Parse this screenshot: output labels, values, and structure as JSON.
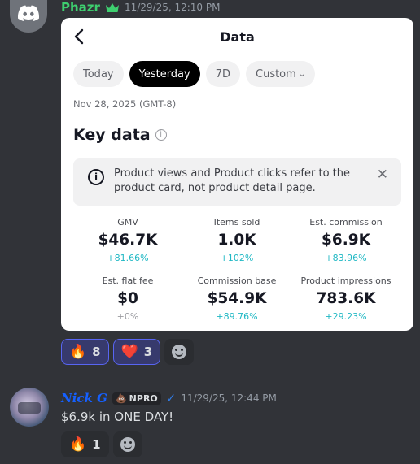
{
  "message1": {
    "author": "Phazr",
    "crown_icon": "crown-icon",
    "timestamp": "11/29/25, 12:10 PM",
    "card": {
      "title": "Data",
      "tabs": [
        {
          "label": "Today",
          "active": false
        },
        {
          "label": "Yesterday",
          "active": true
        },
        {
          "label": "7D",
          "active": false
        },
        {
          "label": "Custom",
          "active": false
        }
      ],
      "date": "Nov 28, 2025 (GMT-8)",
      "section_title": "Key data",
      "notice": "Product views and Product clicks refer to the product card, not product detail page.",
      "metrics": [
        {
          "label": "GMV",
          "value": "$46.7K",
          "change": "+81.66%"
        },
        {
          "label": "Items sold",
          "value": "1.0K",
          "change": "+102%"
        },
        {
          "label": "Est. commission",
          "value": "$6.9K",
          "change": "+83.96%"
        },
        {
          "label": "Est. flat fee",
          "value": "$0",
          "change": "+0%"
        },
        {
          "label": "Commission base",
          "value": "$54.9K",
          "change": "+89.76%"
        },
        {
          "label": "Product impressions",
          "value": "783.6K",
          "change": "+29.23%"
        }
      ]
    },
    "reactions": [
      {
        "emoji": "🔥",
        "count": "8"
      },
      {
        "emoji": "❤️",
        "count": "3"
      }
    ]
  },
  "message2": {
    "author": "Nick G",
    "tag": "NPRO",
    "timestamp": "11/29/25, 12:44 PM",
    "text": "$6.9k in ONE DAY!",
    "reactions": [
      {
        "emoji": "🔥",
        "count": "1"
      }
    ]
  },
  "colors": {
    "background": "#313338",
    "author1": "#3ecf6f",
    "author2": "#1560ff",
    "change_positive": "#20b8c4",
    "reaction_selected": "#5865f2"
  }
}
